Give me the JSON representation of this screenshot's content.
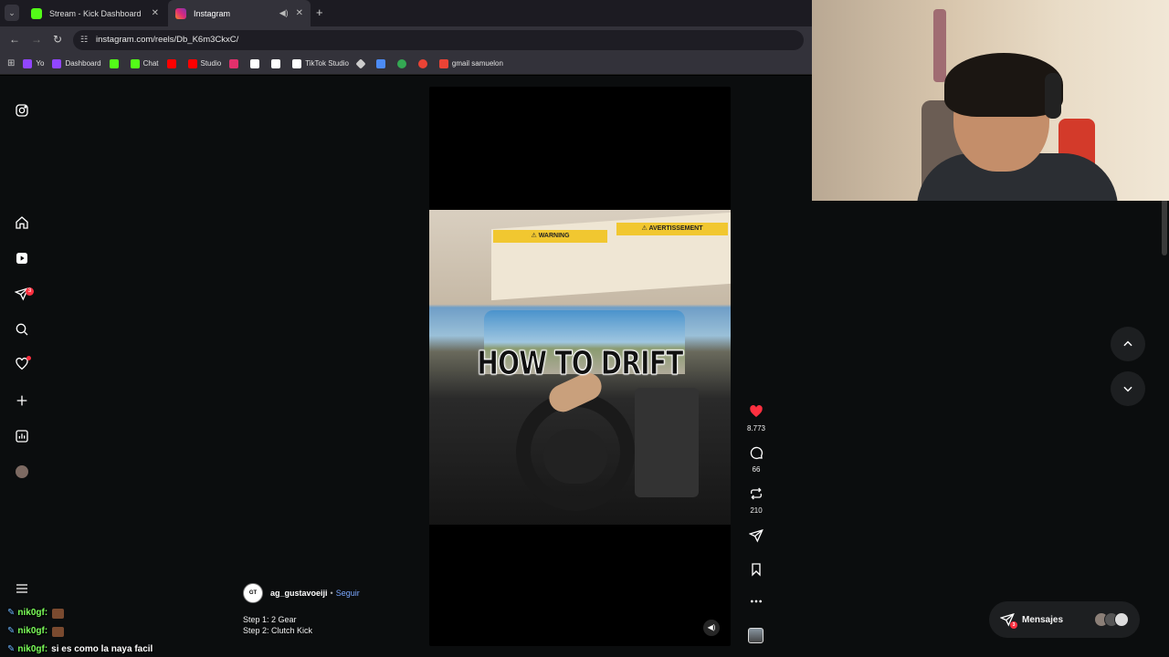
{
  "browser": {
    "tabs": [
      {
        "label": "Stream - Kick Dashboard",
        "favicon_color": "#53fc18"
      },
      {
        "label": "Instagram",
        "favicon_color": "#e1306c"
      }
    ],
    "address": "instagram.com/reels/Db_K6m3CkxC/",
    "bookmarks": [
      {
        "label": "Yo",
        "color": "#9146ff"
      },
      {
        "label": "Dashboard",
        "color": "#9146ff"
      },
      {
        "label": "",
        "color": "#53fc18"
      },
      {
        "label": "Chat",
        "color": "#53fc18"
      },
      {
        "label": "",
        "color": "#ff0000"
      },
      {
        "label": "Studio",
        "color": "#ff0000"
      },
      {
        "label": "",
        "color": "#e1306c"
      },
      {
        "label": "",
        "color": "#ffffff"
      },
      {
        "label": "",
        "color": "#ffffff"
      },
      {
        "label": "TikTok Studio",
        "color": "#ffffff"
      },
      {
        "label": "",
        "color": "#cccccc"
      },
      {
        "label": "",
        "color": "#4c8bf5"
      },
      {
        "label": "",
        "color": "#34a853"
      },
      {
        "label": "",
        "color": "#ea4335"
      },
      {
        "label": "gmail samuelon",
        "color": "#ea4335"
      }
    ]
  },
  "sidebar": {
    "notification_count": "3"
  },
  "reel": {
    "caption": "HOW TO DRIFT",
    "sign_left": "⚠ WARNING",
    "sign_right": "⚠ AVERTISSEMENT",
    "author": "ag_gustavoeiji",
    "follow_label": "Seguir",
    "separator": "•",
    "description_lines": [
      "Step 1: 2 Gear",
      "Step 2: Clutch Kick"
    ],
    "likes": "8.773",
    "comments": "66",
    "reposts": "210",
    "like_color": "#ff3040"
  },
  "messages": {
    "label": "Mensajes",
    "badge": "3"
  },
  "chat": [
    {
      "user": "nik0gf:",
      "message": "",
      "emote": true
    },
    {
      "user": "nik0gf:",
      "message": "",
      "emote": true
    },
    {
      "user": "nik0gf:",
      "message": "si es como la naya facil",
      "emote": false
    }
  ]
}
